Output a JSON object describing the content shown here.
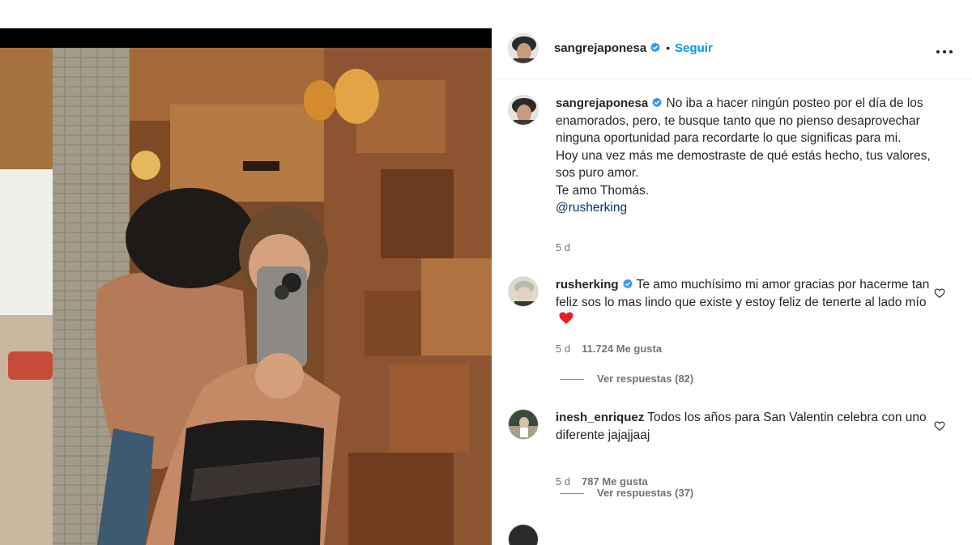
{
  "post": {
    "username": "sangrejaponesa",
    "follow_label": "Seguir",
    "separator": "•"
  },
  "caption": {
    "username": "sangrejaponesa",
    "text": "No iba a hacer ningún posteo por el día de los enamorados, pero, te busque tanto que no pienso desaprovechar ninguna oportunidad para recordarte lo que significas para mi.",
    "text2": "Hoy una vez más me demostraste de qué estás hecho, tus valores, sos puro amor.",
    "text3": "Te amo Thomás.",
    "mention": "@rusherking",
    "time": "5 d"
  },
  "comments": [
    {
      "username": "rusherking",
      "verified": true,
      "text": "Te amo muchísimo mi amor gracias por hacerme tan feliz sos lo mas lindo que existe y estoy feliz de tenerte al lado mío",
      "time": "5 d",
      "likes": "11.724 Me gusta",
      "replies": "Ver respuestas (82)"
    },
    {
      "username": "inesh_enriquez",
      "verified": false,
      "text": "Todos los años para San Valentin celebra con uno diferente jajajjaaj",
      "time": "5 d",
      "likes": "787 Me gusta",
      "replies": "Ver respuestas (37)"
    }
  ],
  "colors": {
    "link_blue": "#0095f6",
    "verified_blue": "#3897f0",
    "mention": "#00376b",
    "muted": "#737373",
    "heart_red": "#ed1c24"
  },
  "icons": [
    "verified-badge-icon",
    "more-options-icon",
    "heart-outline-icon",
    "red-heart-emoji"
  ]
}
